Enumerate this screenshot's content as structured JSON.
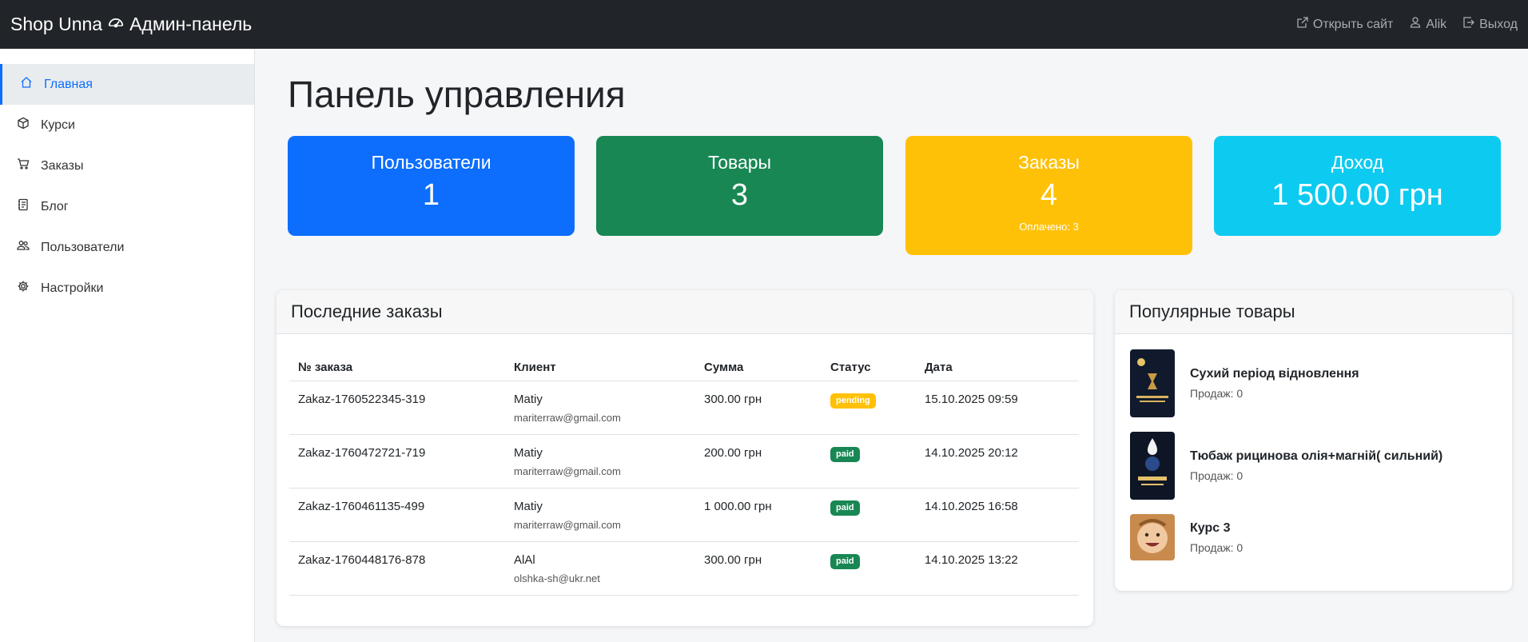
{
  "header": {
    "brand_name": "Shop Unna",
    "brand_section": "Админ-панель",
    "open_site": "Открыть сайт",
    "user": "Alik",
    "logout": "Выход"
  },
  "sidebar": {
    "items": [
      {
        "label": "Главная",
        "icon": "house-icon",
        "active": true
      },
      {
        "label": "Курси",
        "icon": "box-icon"
      },
      {
        "label": "Заказы",
        "icon": "cart-icon"
      },
      {
        "label": "Блог",
        "icon": "journal-icon"
      },
      {
        "label": "Пользователи",
        "icon": "people-icon"
      },
      {
        "label": "Настройки",
        "icon": "gear-icon"
      }
    ]
  },
  "main": {
    "title": "Панель управления",
    "stats": {
      "users": {
        "label": "Пользователи",
        "value": "1",
        "color": "#0d6efd"
      },
      "products": {
        "label": "Товары",
        "value": "3",
        "color": "#198754"
      },
      "orders": {
        "label": "Заказы",
        "value": "4",
        "sub": "Оплачено: 3",
        "color": "#ffc107"
      },
      "income": {
        "label": "Доход",
        "value": "1 500.00 грн",
        "color": "#0dcaf0"
      }
    },
    "recent_orders": {
      "title": "Последние заказы",
      "columns": [
        "№ заказа",
        "Клиент",
        "Сумма",
        "Статус",
        "Дата"
      ],
      "rows": [
        {
          "id": "Zakaz-1760522345-319",
          "client": "Matiy",
          "email": "mariterraw@gmail.com",
          "sum": "300.00 грн",
          "status": "pending",
          "date": "15.10.2025 09:59"
        },
        {
          "id": "Zakaz-1760472721-719",
          "client": "Matiy",
          "email": "mariterraw@gmail.com",
          "sum": "200.00 грн",
          "status": "paid",
          "date": "14.10.2025 20:12"
        },
        {
          "id": "Zakaz-1760461135-499",
          "client": "Matiy",
          "email": "mariterraw@gmail.com",
          "sum": "1 000.00 грн",
          "status": "paid",
          "date": "14.10.2025 16:58"
        },
        {
          "id": "Zakaz-1760448176-878",
          "client": "AlAl",
          "email": "olshka-sh@ukr.net",
          "sum": "300.00 грн",
          "status": "paid",
          "date": "14.10.2025 13:22"
        }
      ]
    },
    "popular": {
      "title": "Популярные товары",
      "items": [
        {
          "name": "Сухий період відновлення",
          "sales": "Продаж: 0"
        },
        {
          "name": "Тюбаж рицинова олія+магній( сильний)",
          "sales": "Продаж: 0"
        },
        {
          "name": "Курс 3",
          "sales": "Продаж: 0"
        }
      ]
    }
  }
}
